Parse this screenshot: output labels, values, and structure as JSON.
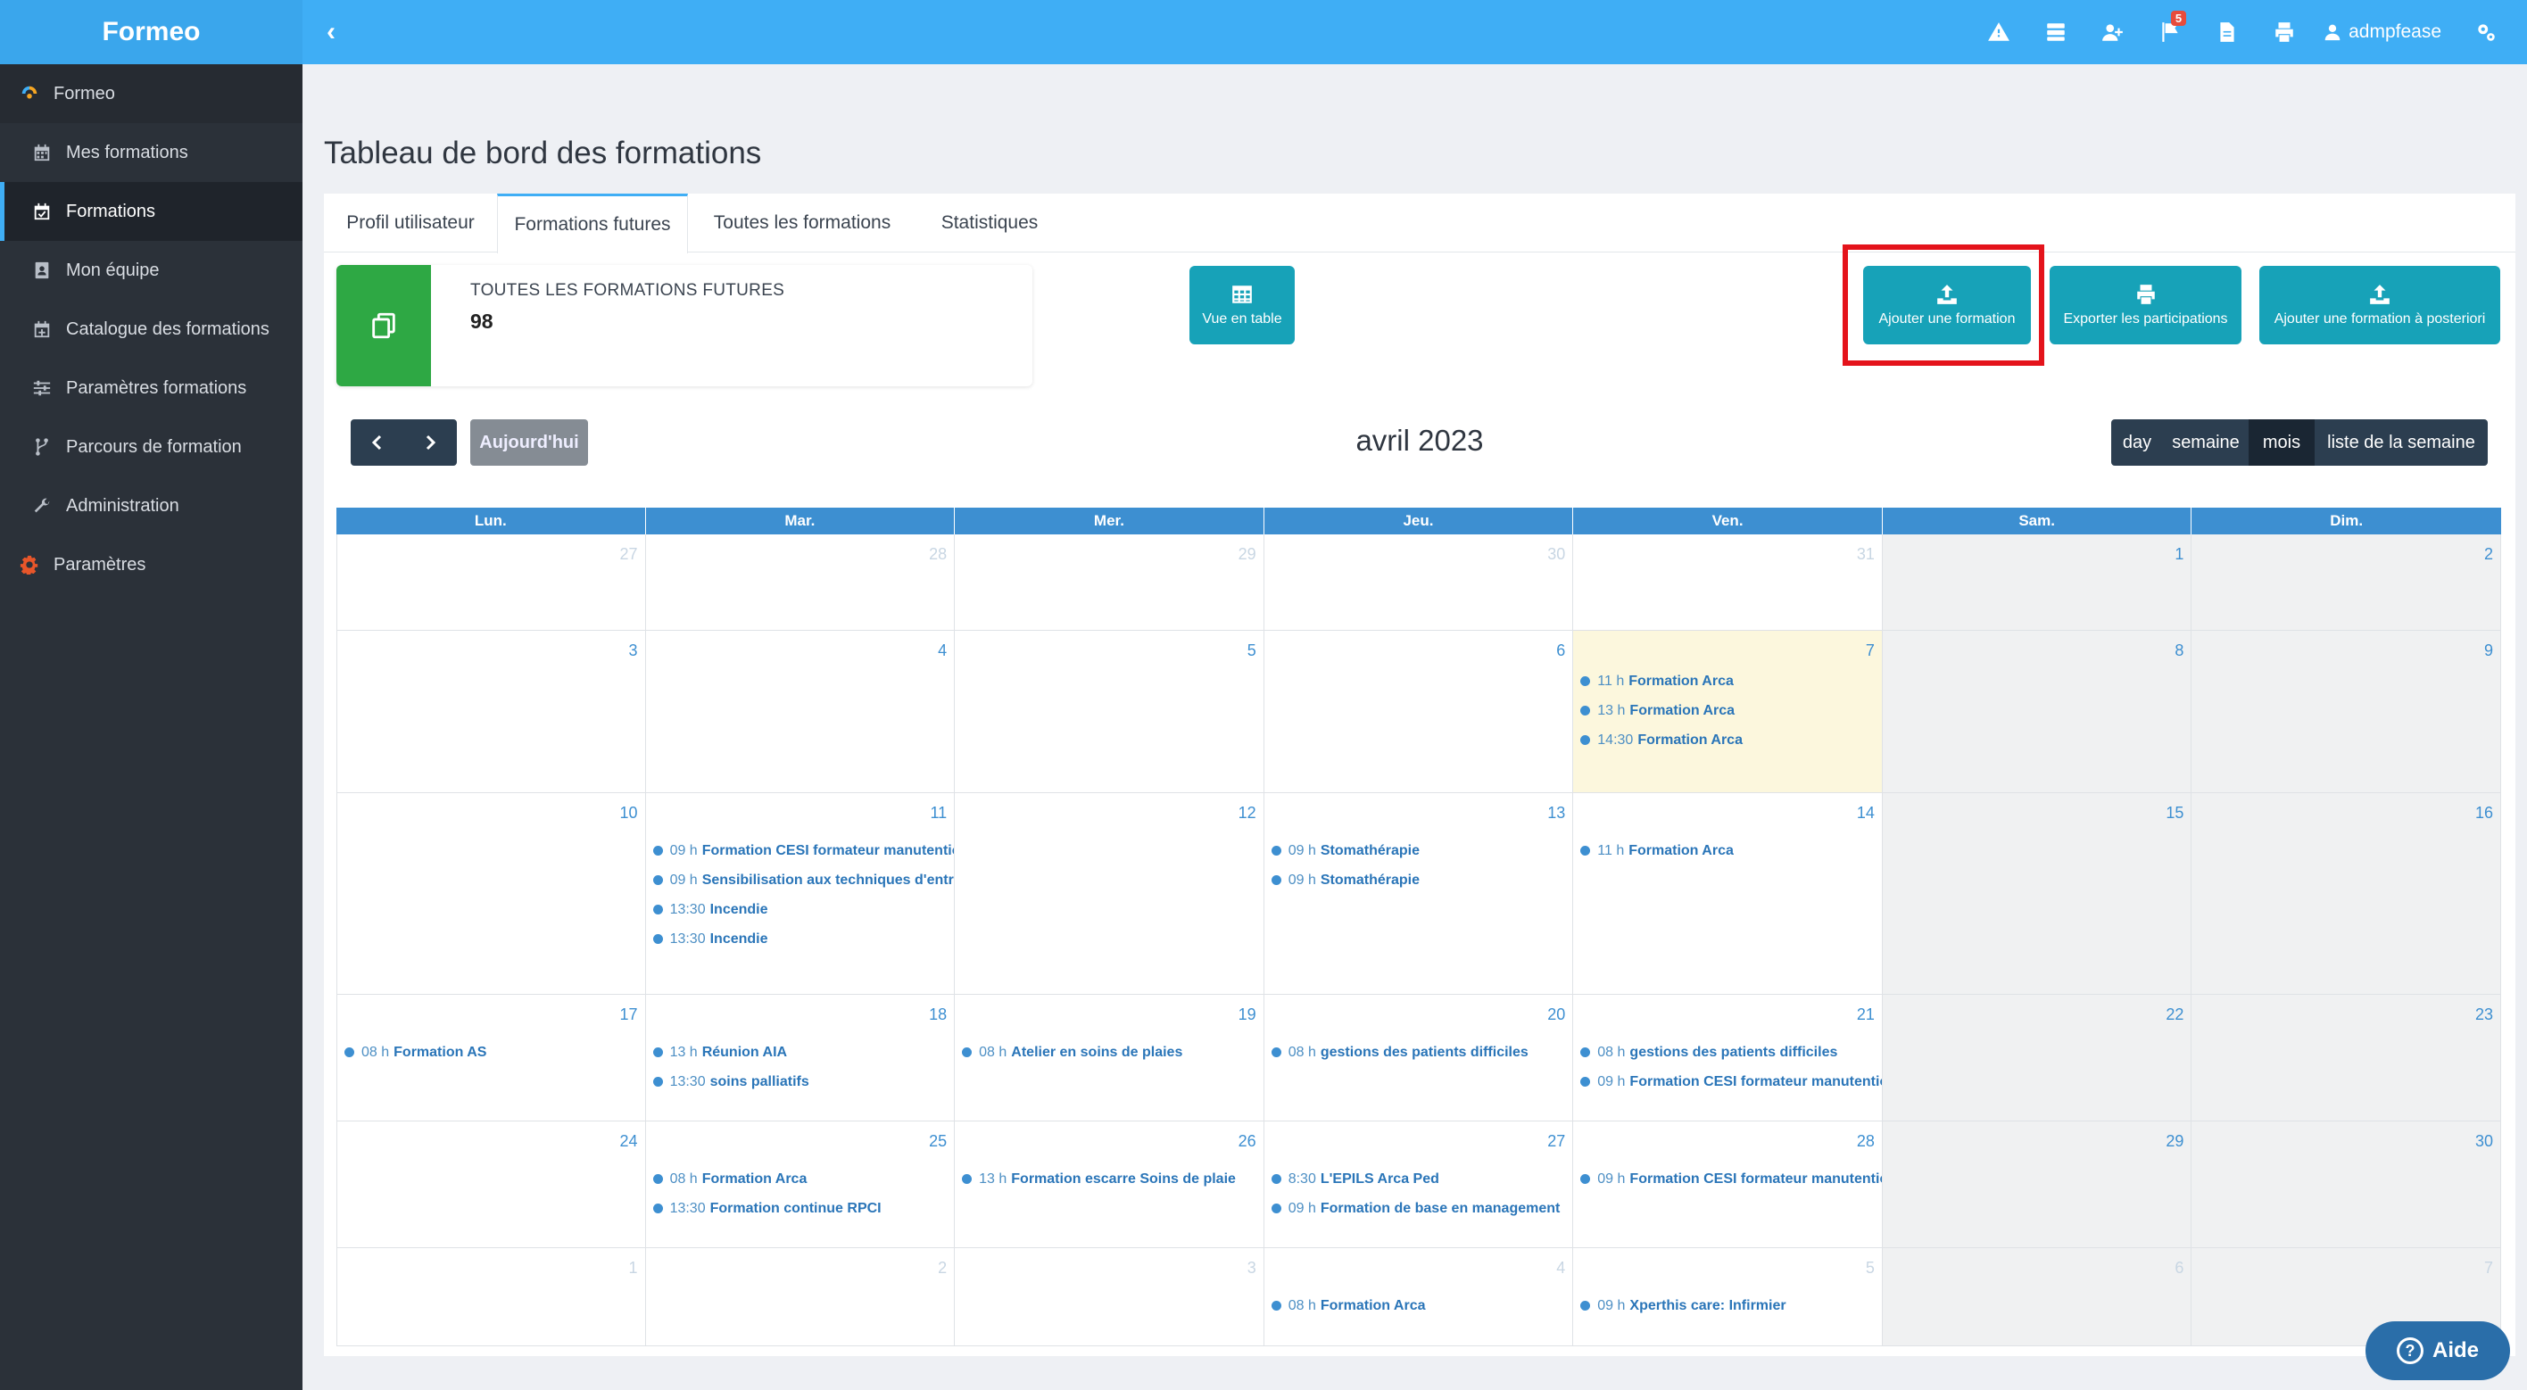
{
  "app": {
    "brand": "Formeo",
    "user": "admpfease",
    "notification_count": "5"
  },
  "sidebar": {
    "root": "Formeo",
    "items": [
      {
        "label": "Mes formations",
        "icon": "calendar-icon",
        "active": false
      },
      {
        "label": "Formations",
        "icon": "calendar-check-icon",
        "active": true
      },
      {
        "label": "Mon équipe",
        "icon": "id-card-icon",
        "active": false
      },
      {
        "label": "Catalogue des formations",
        "icon": "calendar-plus-icon",
        "active": false
      },
      {
        "label": "Paramètres formations",
        "icon": "sliders-icon",
        "active": false
      },
      {
        "label": "Parcours de formation",
        "icon": "branch-icon",
        "active": false
      },
      {
        "label": "Administration",
        "icon": "wrench-icon",
        "active": false
      }
    ],
    "settings": "Paramètres"
  },
  "page": {
    "title": "Tableau de bord des formations"
  },
  "tabs": [
    "Profil utilisateur",
    "Formations futures",
    "Toutes les formations",
    "Statistiques"
  ],
  "active_tab": "Formations futures",
  "stat": {
    "label": "TOUTES LES FORMATIONS FUTURES",
    "value": "98"
  },
  "toolbar": {
    "table_view": "Vue en table",
    "add_training": "Ajouter une formation",
    "export": "Exporter les participations",
    "add_posteriori": "Ajouter une formation à posteriori"
  },
  "calendar": {
    "today_label": "Aujourd'hui",
    "title": "avril 2023",
    "views": [
      "day",
      "semaine",
      "mois",
      "liste de la semaine"
    ],
    "active_view": "mois",
    "weekdays": [
      "Lun.",
      "Mar.",
      "Mer.",
      "Jeu.",
      "Ven.",
      "Sam.",
      "Dim."
    ],
    "today": "7",
    "weeks": [
      {
        "days": [
          {
            "n": "27",
            "other": true,
            "events": []
          },
          {
            "n": "28",
            "other": true,
            "events": []
          },
          {
            "n": "29",
            "other": true,
            "events": []
          },
          {
            "n": "30",
            "other": true,
            "events": []
          },
          {
            "n": "31",
            "other": true,
            "events": []
          },
          {
            "n": "1",
            "events": []
          },
          {
            "n": "2",
            "events": []
          }
        ]
      },
      {
        "days": [
          {
            "n": "3",
            "events": []
          },
          {
            "n": "4",
            "events": []
          },
          {
            "n": "5",
            "events": []
          },
          {
            "n": "6",
            "events": []
          },
          {
            "n": "7",
            "today": true,
            "events": [
              {
                "time": "11 h",
                "title": "Formation Arca"
              },
              {
                "time": "13 h",
                "title": "Formation Arca"
              },
              {
                "time": "14:30",
                "title": "Formation Arca"
              }
            ]
          },
          {
            "n": "8",
            "events": []
          },
          {
            "n": "9",
            "events": []
          }
        ]
      },
      {
        "days": [
          {
            "n": "10",
            "events": []
          },
          {
            "n": "11",
            "events": [
              {
                "time": "09 h",
                "title": "Formation CESI formateur manutention"
              },
              {
                "time": "09 h",
                "title": "Sensibilisation aux techniques d'entretien"
              },
              {
                "time": "13:30",
                "title": "Incendie"
              },
              {
                "time": "13:30",
                "title": "Incendie"
              }
            ]
          },
          {
            "n": "12",
            "events": []
          },
          {
            "n": "13",
            "events": [
              {
                "time": "09 h",
                "title": "Stomathérapie"
              },
              {
                "time": "09 h",
                "title": "Stomathérapie"
              }
            ]
          },
          {
            "n": "14",
            "events": [
              {
                "time": "11 h",
                "title": "Formation Arca"
              }
            ]
          },
          {
            "n": "15",
            "events": []
          },
          {
            "n": "16",
            "events": []
          }
        ]
      },
      {
        "days": [
          {
            "n": "17",
            "events": [
              {
                "time": "08 h",
                "title": "Formation AS"
              }
            ]
          },
          {
            "n": "18",
            "events": [
              {
                "time": "13 h",
                "title": "Réunion AIA"
              },
              {
                "time": "13:30",
                "title": "soins palliatifs"
              }
            ]
          },
          {
            "n": "19",
            "events": [
              {
                "time": "08 h",
                "title": "Atelier en soins de plaies"
              }
            ]
          },
          {
            "n": "20",
            "events": [
              {
                "time": "08 h",
                "title": "gestions des patients difficiles"
              }
            ]
          },
          {
            "n": "21",
            "events": [
              {
                "time": "08 h",
                "title": "gestions des patients difficiles"
              },
              {
                "time": "09 h",
                "title": "Formation CESI formateur manutention"
              }
            ]
          },
          {
            "n": "22",
            "events": []
          },
          {
            "n": "23",
            "events": []
          }
        ]
      },
      {
        "days": [
          {
            "n": "24",
            "events": []
          },
          {
            "n": "25",
            "events": [
              {
                "time": "08 h",
                "title": "Formation Arca"
              },
              {
                "time": "13:30",
                "title": "Formation continue RPCI"
              }
            ]
          },
          {
            "n": "26",
            "events": [
              {
                "time": "13 h",
                "title": "Formation escarre Soins de plaie"
              }
            ]
          },
          {
            "n": "27",
            "events": [
              {
                "time": "8:30",
                "title": "L'EPILS Arca Ped"
              },
              {
                "time": "09 h",
                "title": "Formation de base en management"
              }
            ]
          },
          {
            "n": "28",
            "events": [
              {
                "time": "09 h",
                "title": "Formation CESI formateur manutention"
              }
            ]
          },
          {
            "n": "29",
            "events": []
          },
          {
            "n": "30",
            "events": []
          }
        ]
      },
      {
        "days": [
          {
            "n": "1",
            "other": true,
            "events": []
          },
          {
            "n": "2",
            "other": true,
            "events": []
          },
          {
            "n": "3",
            "other": true,
            "events": []
          },
          {
            "n": "4",
            "other": true,
            "events": [
              {
                "time": "08 h",
                "title": "Formation Arca"
              }
            ]
          },
          {
            "n": "5",
            "other": true,
            "events": [
              {
                "time": "09 h",
                "title": "Xperthis care: Infirmier"
              }
            ]
          },
          {
            "n": "6",
            "other": true,
            "events": []
          },
          {
            "n": "7",
            "other": true,
            "events": []
          }
        ]
      }
    ]
  },
  "help": {
    "label": "Aide"
  }
}
